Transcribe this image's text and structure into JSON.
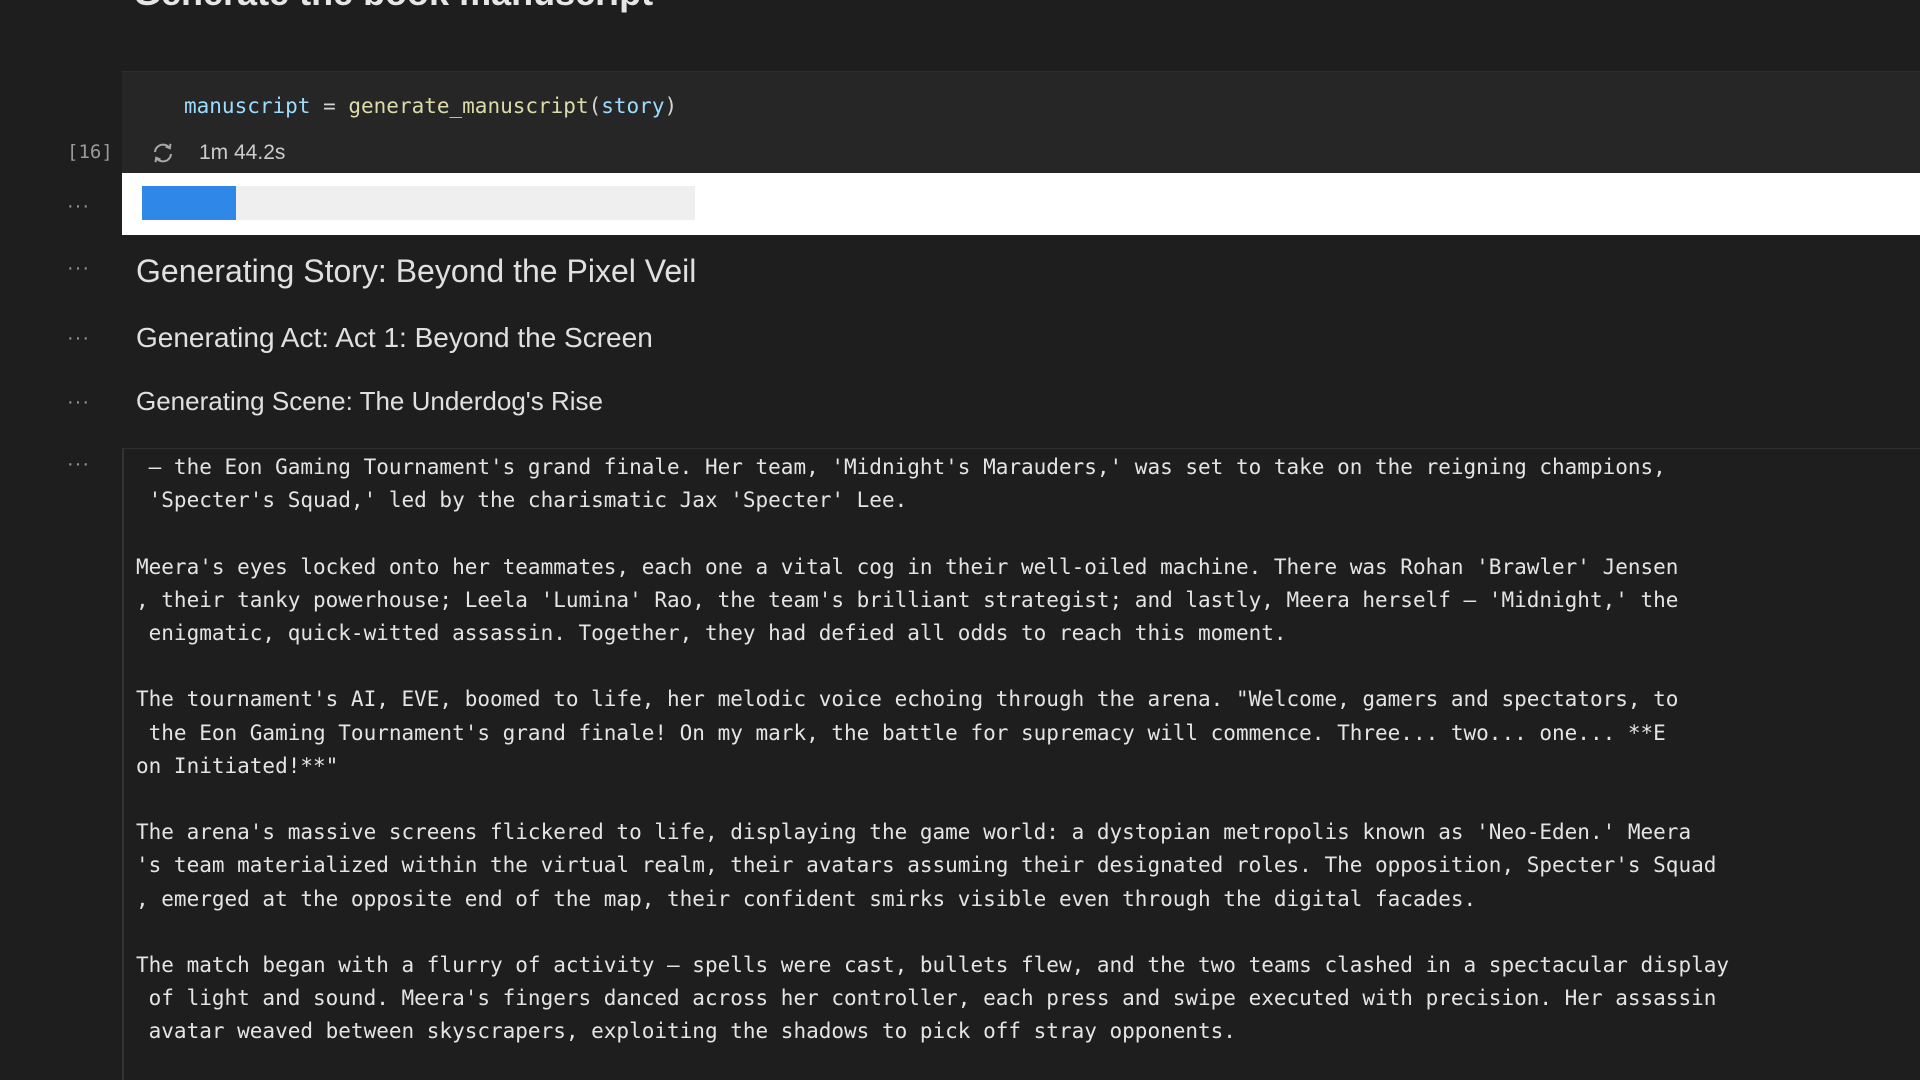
{
  "header": {
    "title": "Generate the book manuscript"
  },
  "code_cell": {
    "execution_count": "[16]",
    "code": {
      "var": "manuscript",
      "op": " = ",
      "fn": "generate_manuscript",
      "open": "(",
      "arg": "story",
      "close": ")"
    },
    "status_icon": "spinner-icon",
    "timing": "1m 44.2s"
  },
  "outputs": {
    "ellipsis": "···",
    "progress": {
      "fraction": 0.17,
      "accent_color": "#2f88e7"
    },
    "story_status": "Generating Story: Beyond the Pixel Veil",
    "act_status": "Generating Act: Act 1: Beyond the Screen",
    "scene_status": "Generating Scene: The Underdog's Rise",
    "text_lines": [
      " — the Eon Gaming Tournament's grand finale. Her team, 'Midnight's Marauders,' was set to take on the reigning champions,",
      " 'Specter's Squad,' led by the charismatic Jax 'Specter' Lee.",
      "",
      "Meera's eyes locked onto her teammates, each one a vital cog in their well-oiled machine. There was Rohan 'Brawler' Jensen",
      ", their tanky powerhouse; Leela 'Lumina' Rao, the team's brilliant strategist; and lastly, Meera herself — 'Midnight,' the",
      " enigmatic, quick-witted assassin. Together, they had defied all odds to reach this moment.",
      "",
      "The tournament's AI, EVE, boomed to life, her melodic voice echoing through the arena. \"Welcome, gamers and spectators, to",
      " the Eon Gaming Tournament's grand finale! On my mark, the battle for supremacy will commence. Three... two... one... **E",
      "on Initiated!**\"",
      "",
      "The arena's massive screens flickered to life, displaying the game world: a dystopian metropolis known as 'Neo-Eden.' Meera",
      "'s team materialized within the virtual realm, their avatars assuming their designated roles. The opposition, Specter's Squad",
      ", emerged at the opposite end of the map, their confident smirks visible even through the digital facades.",
      "",
      "The match began with a flurry of activity — spells were cast, bullets flew, and the two teams clashed in a spectacular display",
      " of light and sound. Meera's fingers danced across her controller, each press and swipe executed with precision. Her assassin",
      " avatar weaved between skyscrapers, exploiting the shadows to pick off stray opponents."
    ]
  }
}
